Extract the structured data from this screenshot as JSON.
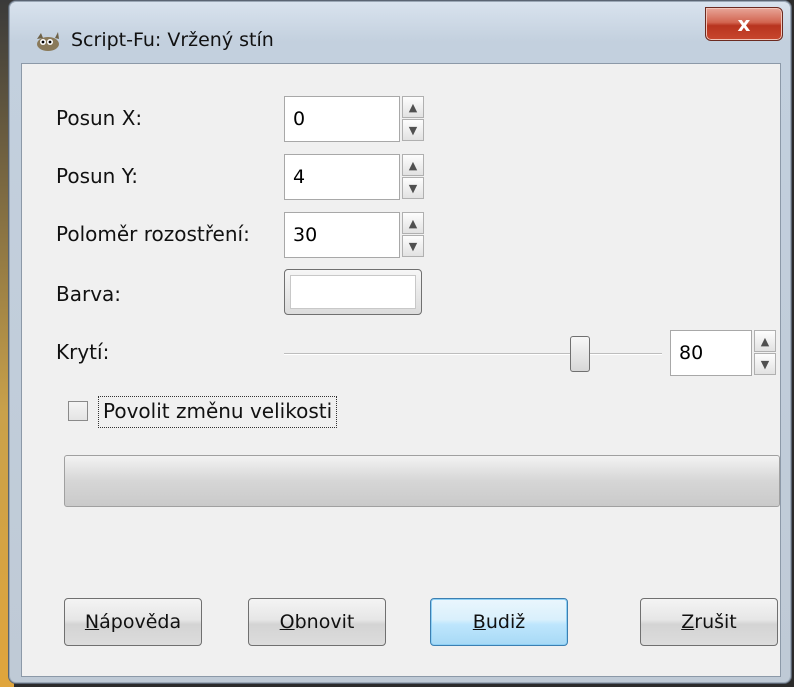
{
  "window": {
    "title": "Script-Fu: Vržený stín",
    "close_label": "x"
  },
  "fields": {
    "offset_x": {
      "label": "Posun X:",
      "value": "0"
    },
    "offset_y": {
      "label": "Posun Y:",
      "value": "4"
    },
    "blur_radius": {
      "label": "Poloměr rozostření:",
      "value": "30"
    },
    "color": {
      "label": "Barva:",
      "value": "#ffffff"
    },
    "opacity": {
      "label": "Krytí:",
      "value": "80",
      "slider_fraction": 0.8
    }
  },
  "checkbox": {
    "label": "Povolit změnu velikosti",
    "checked": false
  },
  "buttons": {
    "help": {
      "mnemonic": "N",
      "rest": "ápověda"
    },
    "reset": {
      "mnemonic": "O",
      "rest": "bnovit"
    },
    "ok": {
      "mnemonic": "B",
      "rest": "udiž"
    },
    "cancel": {
      "mnemonic": "Z",
      "rest": "rušit"
    }
  },
  "icons": {
    "app": "gimp-wilber-icon",
    "spin_up": "arrow-up-icon",
    "spin_down": "arrow-down-icon"
  }
}
